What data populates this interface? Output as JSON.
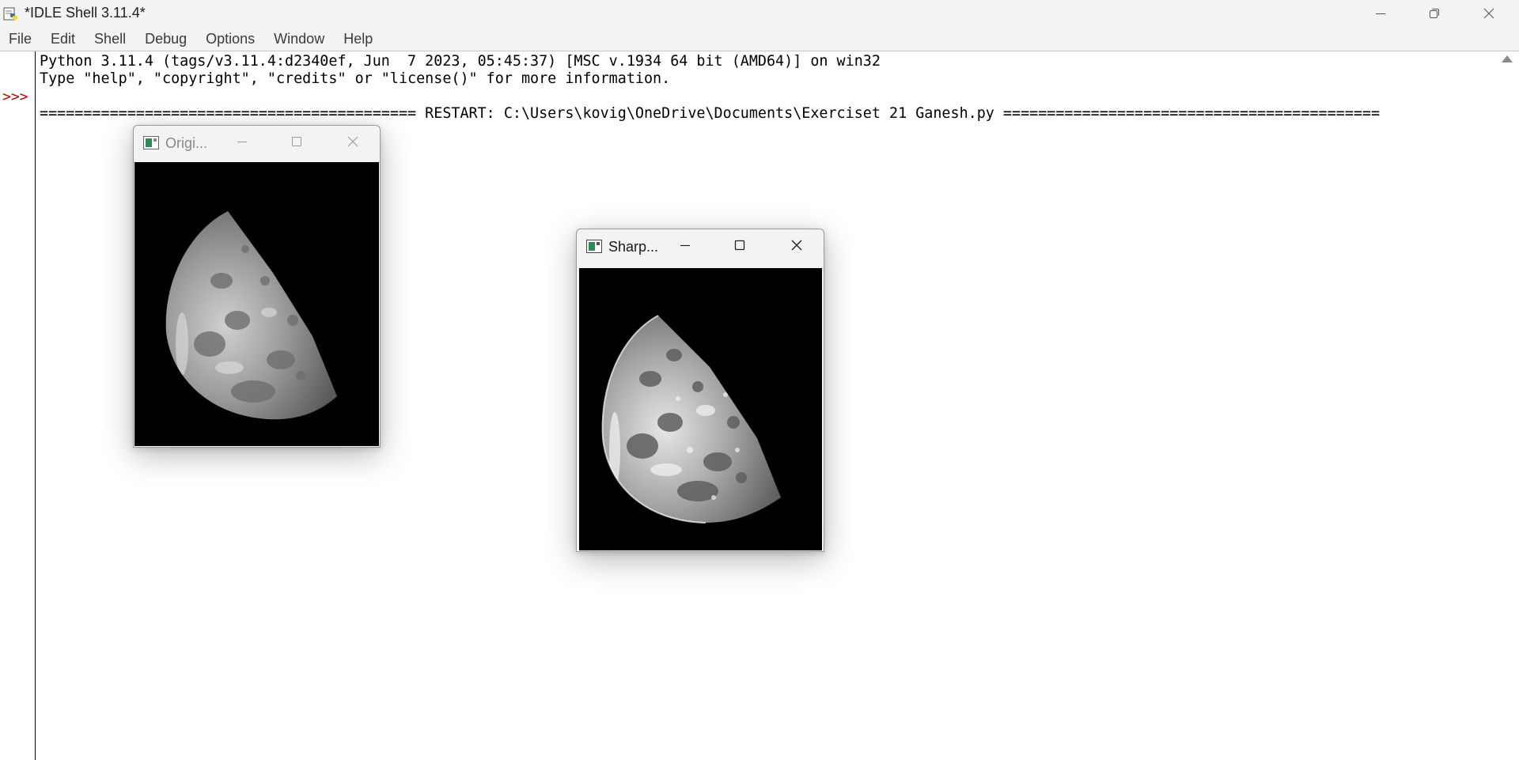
{
  "window": {
    "title": "*IDLE Shell 3.11.4*"
  },
  "menubar": {
    "items": [
      "File",
      "Edit",
      "Shell",
      "Debug",
      "Options",
      "Window",
      "Help"
    ]
  },
  "shell": {
    "prompt": ">>>",
    "lines": [
      "Python 3.11.4 (tags/v3.11.4:d2340ef, Jun  7 2023, 05:45:37) [MSC v.1934 64 bit (AMD64)] on win32",
      "Type \"help\", \"copyright\", \"credits\" or \"license()\" for more information.",
      "=========================================== RESTART: C:\\Users\\kovig\\OneDrive\\Documents\\Exerciset 21 Ganesh.py ==========================================="
    ]
  },
  "windows": [
    {
      "id": "original",
      "title": "Origi...",
      "active": false,
      "image": "moon-grayscale"
    },
    {
      "id": "sharpened",
      "title": "Sharp...",
      "active": true,
      "image": "moon-sharpened"
    }
  ],
  "colors": {
    "prompt": "#c00000",
    "titlebar": "#f3f3f3",
    "image_background": "#000000"
  },
  "icons": [
    "python-idle-icon",
    "minimize-icon",
    "restore-icon",
    "close-icon",
    "opencv-window-icon",
    "maximize-icon",
    "scroll-up-icon"
  ]
}
